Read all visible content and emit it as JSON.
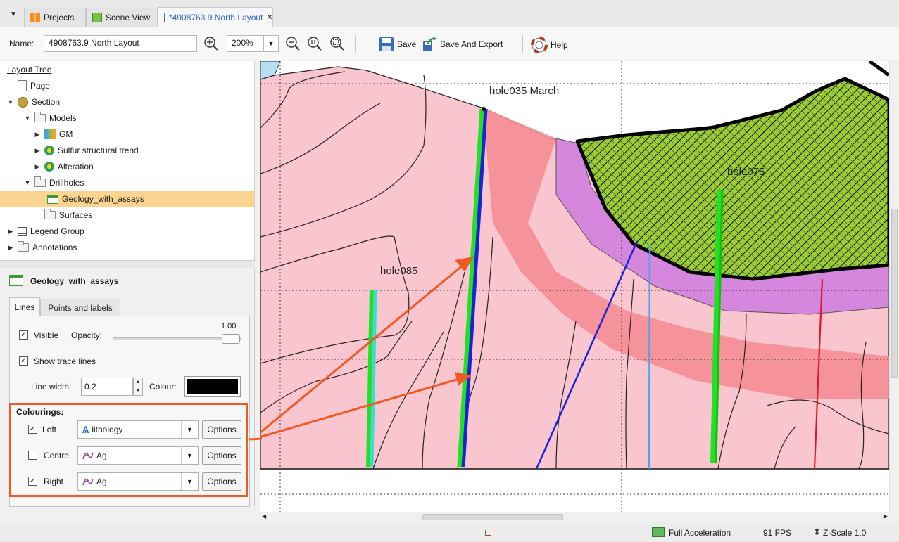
{
  "tabs": {
    "menu_arrow": "▼",
    "projects": "Projects",
    "scene_view": "Scene View",
    "layout": "*4908763.9 North Layout",
    "close": "✕"
  },
  "toolbar": {
    "name_label": "Name:",
    "name_value": "4908763.9 North Layout",
    "zoom_value": "200%",
    "save": "Save",
    "save_export": "Save And Export",
    "help": "Help"
  },
  "tree": {
    "title": "Layout Tree",
    "nodes": [
      "Page",
      "Section",
      "Models",
      "GM",
      "Sulfur structural trend",
      "Alteration",
      "Drillholes",
      "Geology_with_assays",
      "Surfaces",
      "Legend Group",
      "Annotations"
    ]
  },
  "props": {
    "title": "Geology_with_assays",
    "tab_lines": "Lines",
    "tab_points": "Points and labels",
    "visible": "Visible",
    "opacity_label": "Opacity:",
    "opacity_value": "1.00",
    "opacity_fraction": 1.0,
    "show_trace": "Show trace lines",
    "line_width_label": "Line width:",
    "line_width_value": "0.2",
    "colour_label": "Colour:",
    "colour_value": "#000000",
    "colourings_label": "Colourings:",
    "rows": [
      {
        "label": "Left",
        "checked": true,
        "value": "lithology",
        "options": "Options"
      },
      {
        "label": "Centre",
        "checked": false,
        "value": "Ag",
        "options": "Options"
      },
      {
        "label": "Right",
        "checked": true,
        "value": "Ag",
        "options": "Options"
      }
    ]
  },
  "canvas": {
    "hole035": "hole035 March",
    "hole075": "hole075",
    "hole085": "hole085"
  },
  "status": {
    "acceleration": "Full Acceleration",
    "fps": "91 FPS",
    "zscale": "Z-Scale 1.0"
  },
  "colors": {
    "highlight_box": "#f05a22",
    "arrow": "#f05a22",
    "pink_rock": "#f9c5cf",
    "red_alteration": "#f58d93",
    "purple_alteration": "#d487dd",
    "green_unit": "#9acd32",
    "selected_row": "#fbd490",
    "tab_text": "#2b64b8"
  }
}
